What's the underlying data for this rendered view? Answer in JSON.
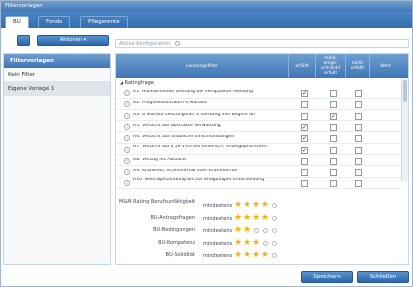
{
  "window": {
    "title": "Filtervorlagen"
  },
  "tabs": [
    "BU",
    "Fonds",
    "Pflegerente"
  ],
  "toolbar": {
    "add": "+",
    "remove": "−",
    "actions": "Aktionen ▾"
  },
  "sidebar": {
    "header": "Filtervorlagen",
    "items": [
      "Kein Filter",
      "Eigene Vorlage 1"
    ]
  },
  "config": {
    "label": "Aktive Konfiguration:"
  },
  "grid": {
    "columns": [
      "Leistungsfilter",
      "erfüllt",
      "mind. einge- schränkt erfüllt",
      "nicht erfüllt",
      "Wert"
    ],
    "group": "Ratingfrage",
    "rows": [
      {
        "text": "R1: Rückwirkende Leistung bei verspäteter Meldung",
        "checks": [
          true,
          false,
          false
        ]
      },
      {
        "text": "R2: Prognosezeitraum 6 Monate",
        "checks": [
          false,
          false,
          false
        ]
      },
      {
        "text": "R3: 6 Monate Leistungsfall = Leistung von Beginn an",
        "checks": [
          false,
          true,
          false
        ]
      },
      {
        "text": "R5: Verzicht auf abstrakte Verweisung",
        "checks": [
          true,
          false,
          false
        ]
      },
      {
        "text": "R6: Verzicht auf unübliche Einschränkungen",
        "checks": [
          true,
          false,
          false
        ]
      },
      {
        "text": "R7: Verzicht auf § 19 VVG bei unversch. Anzeigepflichtverl.",
        "checks": [
          true,
          false,
          false
        ]
      },
      {
        "text": "R8: Verzug ins Ausland",
        "checks": [
          false,
          false,
          false
        ]
      },
      {
        "text": "R9: Krankheit, Kräfteverfall oder Kräfteverfall",
        "checks": [
          false,
          false,
          false
        ]
      },
      {
        "text": "R10: Beitragsstundung bis zur endgültigen Entscheidung",
        "checks": [
          false,
          false,
          false
        ]
      }
    ]
  },
  "ratings": {
    "min_label": "mindestens",
    "items": [
      {
        "label": "M&M Rating Berufsunfähigkeit",
        "stars": 4
      },
      {
        "label": "BU-Antragsfragen",
        "stars": 4
      },
      {
        "label": "BU-Bedingungen",
        "stars": 2
      },
      {
        "label": "BU-Kompetenz",
        "stars": 3
      },
      {
        "label": "BU-Solidität",
        "stars": 4
      }
    ]
  },
  "buttons": {
    "save": "Speichern",
    "close": "Schließen"
  },
  "colors": {
    "header_blue": "#3f76b5",
    "star": "#f1b500"
  }
}
